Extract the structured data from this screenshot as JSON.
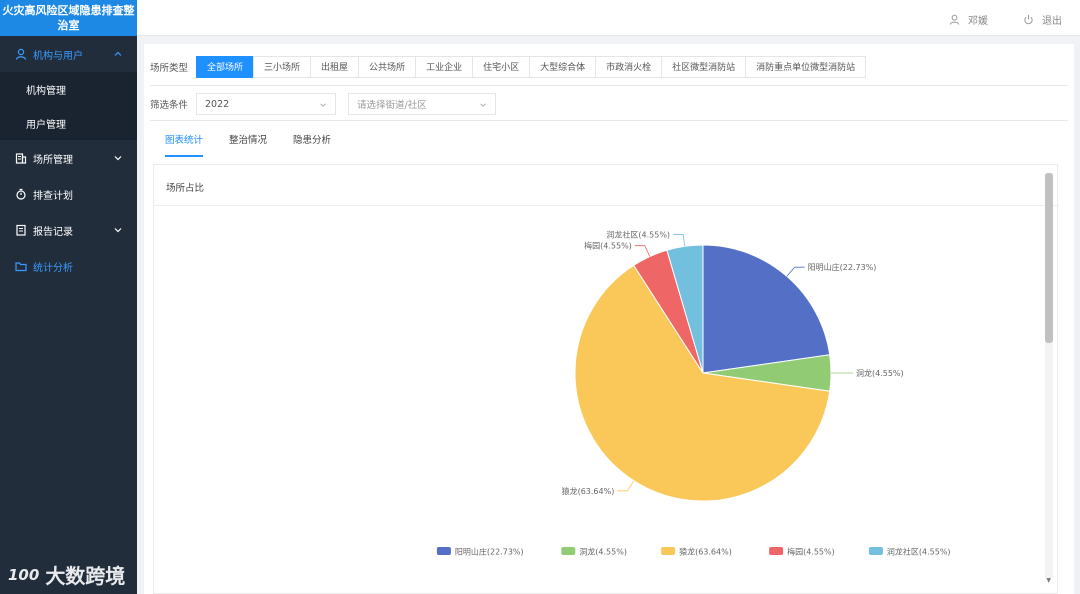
{
  "sidebar": {
    "brand": "火灾高风险区域隐患排查整治室",
    "groups": [
      {
        "label": "机构与用户",
        "icon": "user-icon",
        "expanded": true,
        "children": [
          "机构管理",
          "用户管理"
        ]
      },
      {
        "label": "场所管理",
        "icon": "building-icon"
      },
      {
        "label": "排查计划",
        "icon": "stopwatch-icon"
      },
      {
        "label": "报告记录",
        "icon": "report-icon"
      },
      {
        "label": "统计分析",
        "icon": "folder-icon",
        "active": true
      }
    ],
    "watermark": "大数跨境",
    "watermark_logo": "100"
  },
  "header": {
    "user": "邓媛",
    "logout": "退出"
  },
  "filters": {
    "type_label": "场所类型",
    "types": [
      "全部场所",
      "三小场所",
      "出租屋",
      "公共场所",
      "工业企业",
      "住宅小区",
      "大型综合体",
      "市政消火栓",
      "社区微型消防站",
      "消防重点单位微型消防站"
    ],
    "active_type": 0,
    "condition_label": "筛选条件",
    "year": "2022",
    "street_placeholder": "请选择街道/社区"
  },
  "subtabs": {
    "items": [
      "图表统计",
      "整治情况",
      "隐患分析"
    ],
    "active": 0
  },
  "card": {
    "title": "场所占比"
  },
  "colors": {
    "accent": "#1e90ff",
    "sidebar_bg": "#222d3c",
    "active_menu": "#3a9bff"
  },
  "chart_data": {
    "type": "pie",
    "slices": [
      {
        "name": "阳明山庄",
        "value": 22.73,
        "label": "阳明山庄(22.73%)",
        "legend": "阳明山庄(22.73%)",
        "color": "#5470c6"
      },
      {
        "name": "洞龙",
        "value": 4.55,
        "label": "洞龙(4.55%)",
        "legend": "洞龙(4.55%)",
        "color": "#91cc75"
      },
      {
        "name": "猿龙",
        "value": 63.64,
        "label": "猿龙(63.64%)",
        "legend": "猿龙(63.64%)",
        "color": "#fac858"
      },
      {
        "name": "梅园",
        "value": 4.55,
        "label": "梅园(4.55%)",
        "legend": "梅园(4.55%)",
        "color": "#ee6666"
      },
      {
        "name": "润龙社区",
        "value": 4.55,
        "label": "润龙社区(4.55%)",
        "legend": "润龙社区(4.55%)",
        "color": "#73c0de"
      }
    ],
    "legend_position": "bottom"
  }
}
